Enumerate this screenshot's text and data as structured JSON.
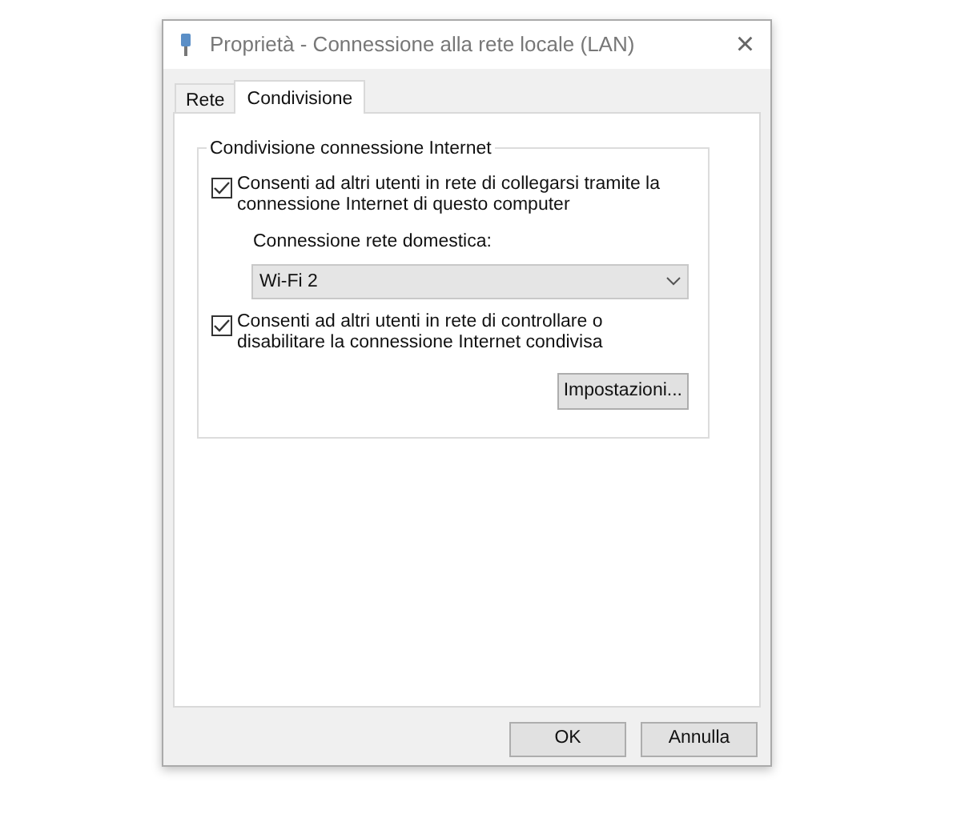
{
  "window": {
    "title": "Proprietà - Connessione alla rete locale (LAN)",
    "close": "×"
  },
  "tabs": [
    {
      "label": "Rete",
      "selected": false
    },
    {
      "label": "Condivisione",
      "selected": true
    }
  ],
  "group": {
    "title": "Condivisione connessione Internet",
    "items": [
      {
        "kind": "checkbox",
        "label": "Consenti ad altri utenti in rete di collegarsi tramite la connessione Internet di questo computer",
        "checked": true
      },
      {
        "kind": "label",
        "label": "Connessione rete domestica:"
      },
      {
        "kind": "dropdown",
        "value": "Wi-Fi 2"
      },
      {
        "kind": "checkbox",
        "label": "Consenti ad altri utenti in rete di controllare o disabilitare la connessione Internet condivisa",
        "checked": true
      },
      {
        "kind": "button",
        "label": "Impostazioni..."
      }
    ]
  },
  "buttons": [
    "OK",
    "Annulla"
  ]
}
